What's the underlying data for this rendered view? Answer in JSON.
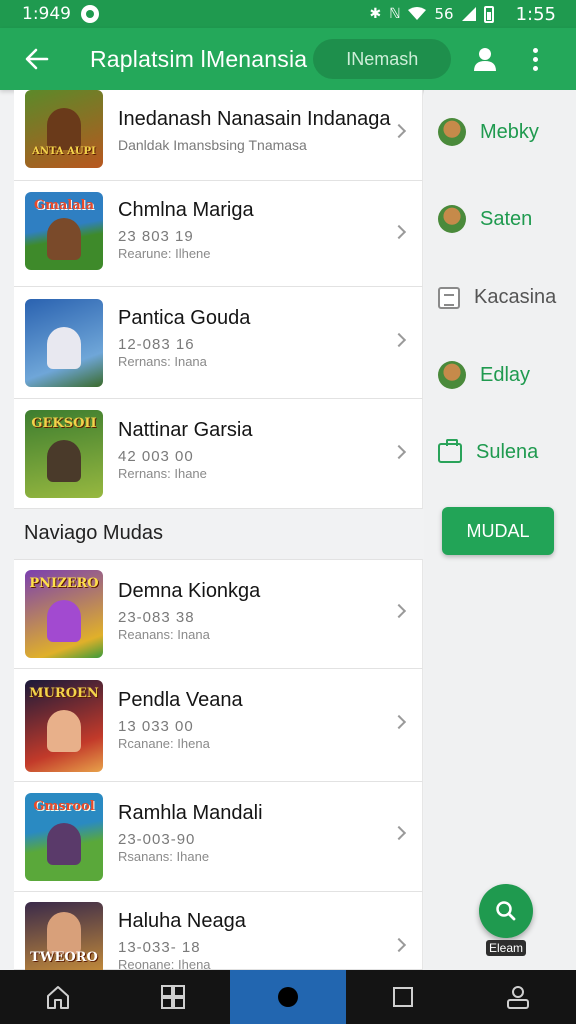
{
  "status_bar": {
    "time_left": "1:949",
    "signal_text": "56",
    "time_right": "1:55"
  },
  "app_bar": {
    "title": "Raplatsim lMenansia",
    "search_pill": "INemash"
  },
  "games": [
    {
      "name": "Inedanash Nanasain Indanaga",
      "subtitle": "Danldak Imansbsing Tnamasa",
      "thumb_word": "ANTA AUPI",
      "colors": [
        "#5b8a2a",
        "#b8571f"
      ]
    },
    {
      "name": "Chmlna Mariga",
      "meta": "23 803 19",
      "sub": "Rearune: Ilhene",
      "thumb_word": "Gmalala",
      "colors": [
        "#2f7fc2",
        "#3e8a2a"
      ]
    },
    {
      "name": "Pantica Gouda",
      "meta": "12-083 16",
      "sub": "Rernans: Inana",
      "thumb_word": "",
      "colors": [
        "#2a62b0",
        "#6fa6d8"
      ]
    },
    {
      "name": "Nattinar Garsia",
      "meta": "42 003 00",
      "sub": "Rernans: Ihane",
      "thumb_word": "GEKSOII",
      "colors": [
        "#3d7d2f",
        "#97b840"
      ]
    }
  ],
  "section_title": "Naviago Mudas",
  "games2": [
    {
      "name": "Demna Kionkga",
      "meta": "23-083 38",
      "sub": "Reanans: Inana",
      "thumb_word": "PNIZERO",
      "colors": [
        "#7a3fb0",
        "#e0b02a"
      ]
    },
    {
      "name": "Pendla Veana",
      "meta": "13 033 00",
      "sub": "Rcanane: Ihena",
      "thumb_word": "MUROEN",
      "colors": [
        "#1a1a3a",
        "#c23a2a"
      ]
    },
    {
      "name": "Ramhla Mandali",
      "meta": "23-003-90",
      "sub": "Rsanans: Ihane",
      "thumb_word": "Gmsrool",
      "colors": [
        "#2a8ac2",
        "#5aa83a"
      ]
    },
    {
      "name": "Haluha Neaga",
      "meta": "13-033- 18",
      "sub": "Reonane: Ihena",
      "thumb_word": "TWEORO",
      "colors": [
        "#3a2a4a",
        "#c28a3a"
      ]
    }
  ],
  "side_nav": [
    {
      "label": "Mebky",
      "icon": "game-icon",
      "style": "green"
    },
    {
      "label": "Saten",
      "icon": "game-icon",
      "style": "green"
    },
    {
      "label": "Kacasina",
      "icon": "document-icon",
      "style": "gray"
    },
    {
      "label": "Edlay",
      "icon": "game-icon",
      "style": "green"
    },
    {
      "label": "Sulena",
      "icon": "briefcase-icon",
      "style": "green"
    }
  ],
  "modal_button": "MUDAL",
  "fab_label": "Eleam",
  "colors": {
    "primary": "#24a85a",
    "status": "#1f9a4f",
    "active_nav": "#2266b0"
  }
}
